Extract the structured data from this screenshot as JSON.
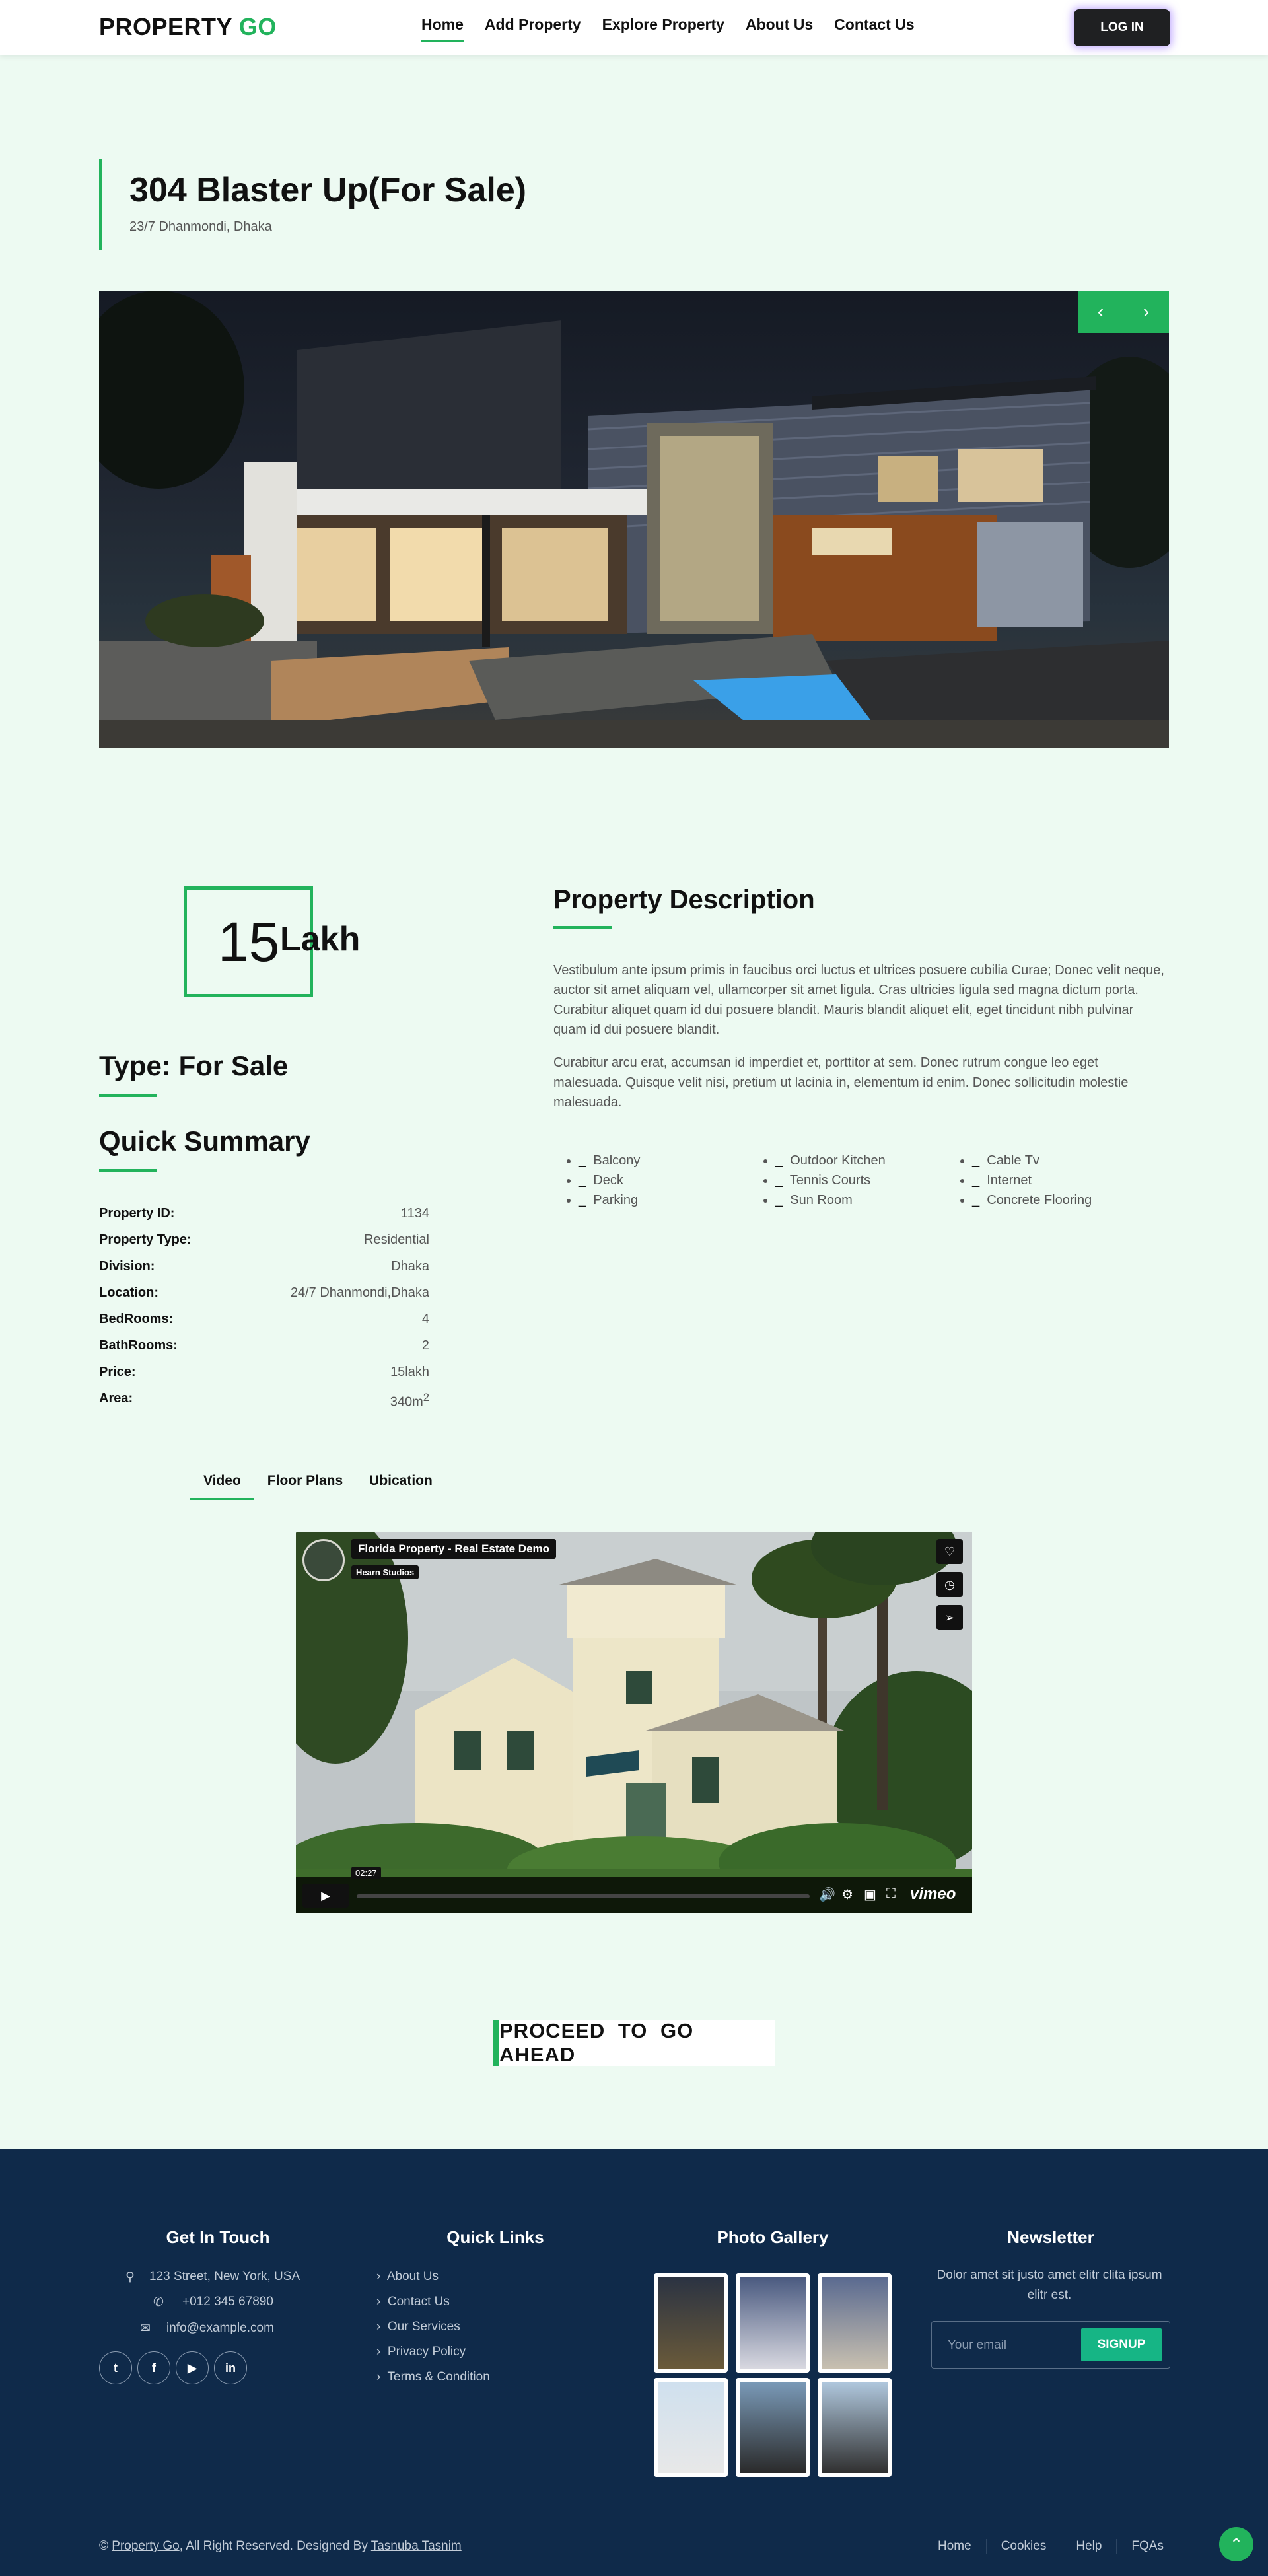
{
  "nav": {
    "logo_main": "PROPERTY",
    "logo_accent": "GO",
    "links": [
      "Home",
      "Add Property",
      "Explore Property",
      "About Us",
      "Contact Us"
    ],
    "login": "LOG IN"
  },
  "property": {
    "title": "304 Blaster Up(For Sale)",
    "address": "23/7 Dhanmondi, Dhaka",
    "price_value": "15",
    "price_unit": "Lakh",
    "type_heading": "Type: For Sale",
    "summary_heading": "Quick Summary",
    "summary": [
      {
        "label": "Property ID:",
        "value": "1134"
      },
      {
        "label": "Property Type:",
        "value": "Residential"
      },
      {
        "label": "Division:",
        "value": "Dhaka"
      },
      {
        "label": "Location:",
        "value": "24/7 Dhanmondi,Dhaka"
      },
      {
        "label": "BedRooms:",
        "value": "4"
      },
      {
        "label": "BathRooms:",
        "value": "2"
      },
      {
        "label": "Price:",
        "value": "15lakh"
      },
      {
        "label": "Area:",
        "value": "340m",
        "sup": "2"
      }
    ]
  },
  "description": {
    "heading": "Property Description",
    "para1": "Vestibulum ante ipsum primis in faucibus orci luctus et ultrices posuere cubilia Curae; Donec velit neque, auctor sit amet aliquam vel, ullamcorper sit amet ligula. Cras ultricies ligula sed magna dictum porta. Curabitur aliquet quam id dui posuere blandit. Mauris blandit aliquet elit, eget tincidunt nibh pulvinar quam id dui posuere blandit.",
    "para2": "Curabitur arcu erat, accumsan id imperdiet et, porttitor at sem. Donec rutrum congue leo eget malesuada. Quisque velit nisi, pretium ut lacinia in, elementum id enim. Donec sollicitudin molestie malesuada.",
    "amenities": [
      "Balcony",
      "Outdoor Kitchen",
      "Cable Tv",
      "Deck",
      "Tennis Courts",
      "Internet",
      "Parking",
      "Sun Room",
      "Concrete Flooring"
    ]
  },
  "media": {
    "tabs": [
      "Video",
      "Floor Plans",
      "Ubication"
    ],
    "video_title": "Florida Property - Real Estate Demo",
    "video_author": "Hearn Studios",
    "video_time": "02:27",
    "video_brand": "vimeo"
  },
  "cta": "PROCEED TO GO AHEAD",
  "footer": {
    "contact_heading": "Get In Touch",
    "address": "123 Street, New York, USA",
    "phone": "+012 345 67890",
    "email": "info@example.com",
    "social": [
      "twitter-icon",
      "facebook-icon",
      "youtube-icon",
      "linkedin-icon"
    ],
    "links_heading": "Quick Links",
    "links": [
      "About Us",
      "Contact Us",
      "Our Services",
      "Privacy Policy",
      "Terms & Condition"
    ],
    "gallery_heading": "Photo Gallery",
    "newsletter_heading": "Newsletter",
    "newsletter_text": "Dolor amet sit justo amet elitr clita ipsum elitr est.",
    "email_placeholder": "Your email",
    "signup": "SIGNUP",
    "copyright_prefix": "©",
    "copyright_brand": "Property Go",
    "copyright_mid": ", All Right Reserved. Designed By",
    "copyright_author": "Tasnuba Tasnim",
    "bottom_links": [
      "Home",
      "Cookies",
      "Help",
      "FQAs"
    ]
  },
  "colors": {
    "accent": "#22b35c",
    "footer_bg": "#0f2a4a",
    "page_bg": "#edfaf2"
  }
}
